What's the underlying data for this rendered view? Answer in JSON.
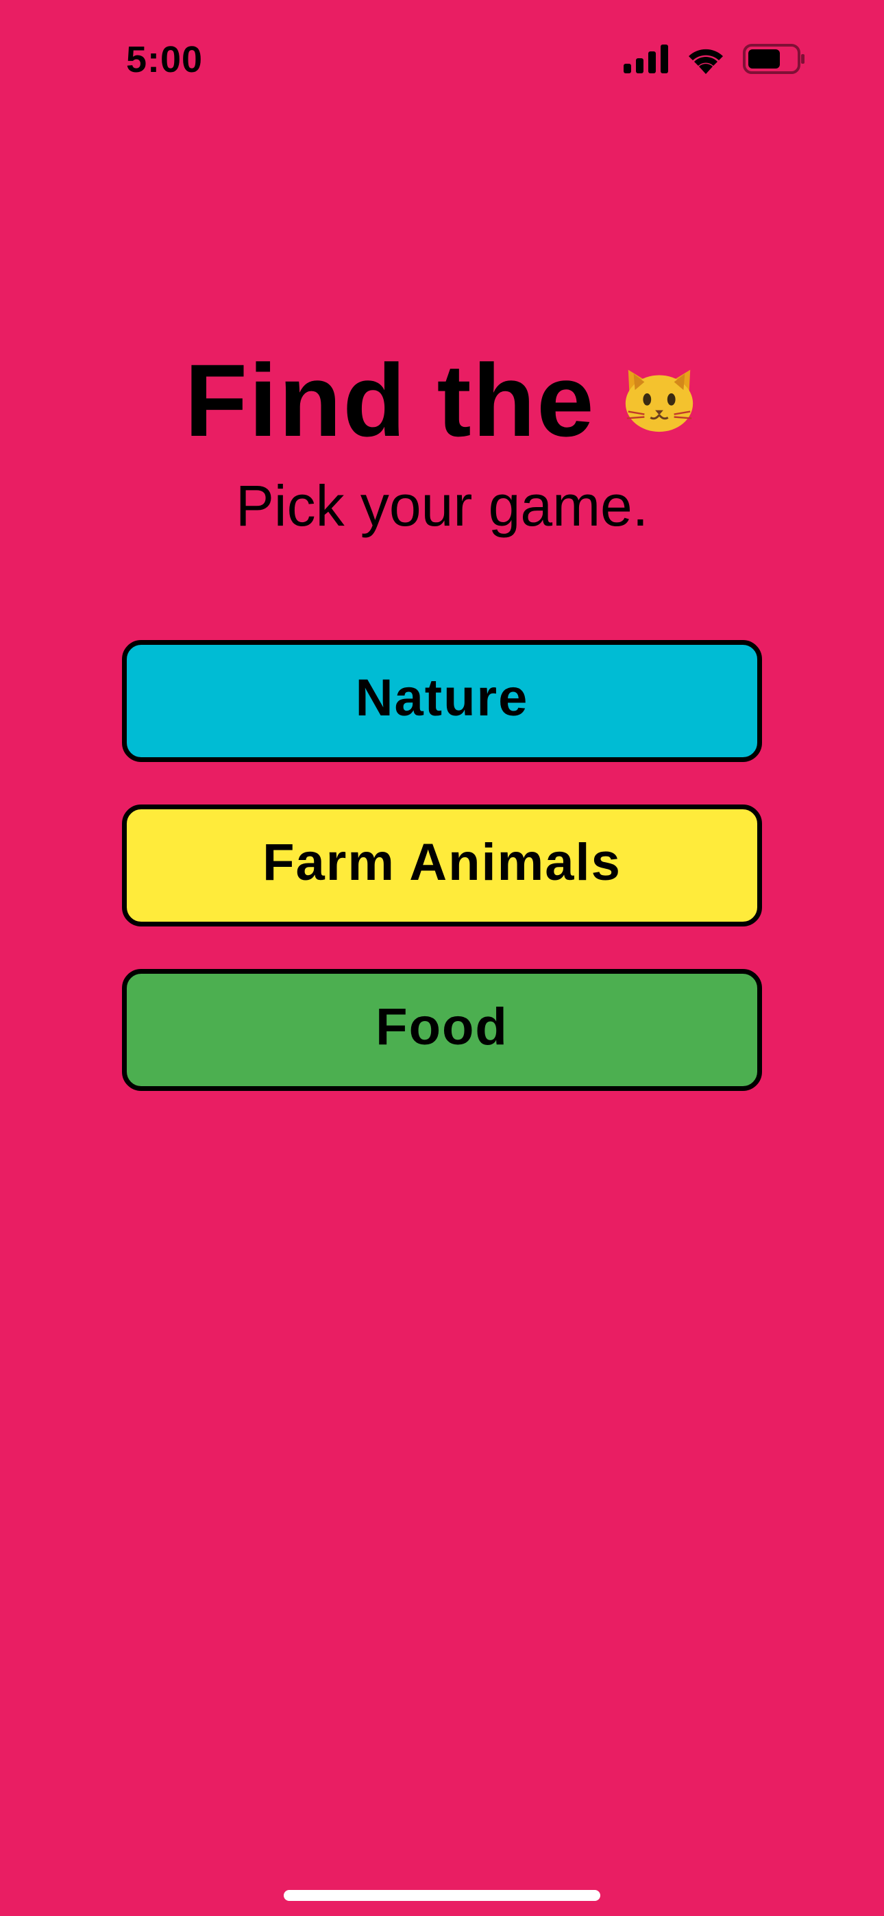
{
  "status_bar": {
    "time": "5:00"
  },
  "header": {
    "title": "Find the",
    "title_emoji_icon": "cat-face-emoji",
    "subtitle": "Pick your game."
  },
  "games": [
    {
      "label": "Nature",
      "color": "#00BCD4"
    },
    {
      "label": "Farm Animals",
      "color": "#FFEB3B"
    },
    {
      "label": "Food",
      "color": "#4CAF50"
    }
  ],
  "colors": {
    "background": "#E91E63",
    "text": "#000000",
    "button_border": "#000000",
    "home_indicator": "#FFFFFF"
  }
}
